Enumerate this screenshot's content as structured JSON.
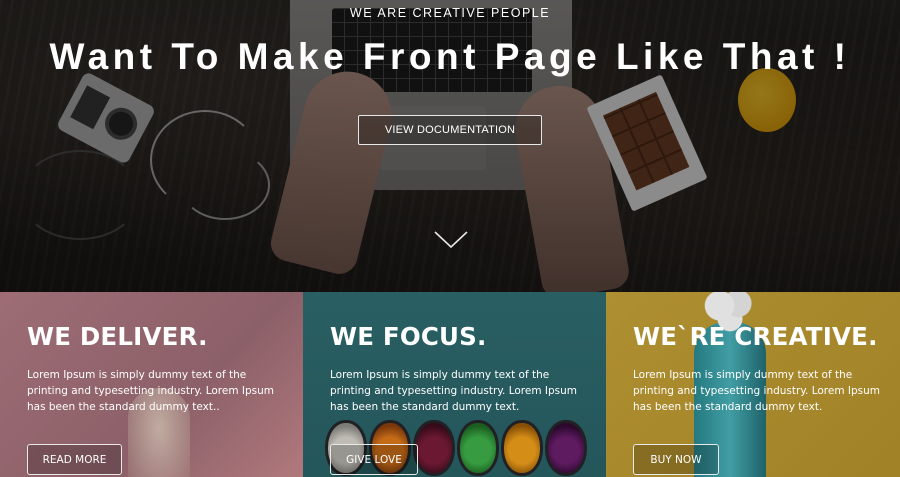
{
  "hero": {
    "subtitle": "WE ARE CREATIVE PEOPLE",
    "title": "Want To Make Front Page Like That !",
    "button_label": "VIEW DOCUMENTATION",
    "scroll_icon": "chevron-down-icon"
  },
  "panels": [
    {
      "heading": "WE DELIVER.",
      "text": "Lorem Ipsum is simply dummy text of the printing and typesetting industry. Lorem Ipsum has been the standard dummy text..",
      "button_label": "READ MORE",
      "color": "#b47c86"
    },
    {
      "heading": "WE FOCUS.",
      "text": "Lorem Ipsum is simply dummy text of the printing and typesetting industry. Lorem Ipsum has been the standard dummy text.",
      "button_label": "GIVE LOVE",
      "color": "#2f6c71"
    },
    {
      "heading": "WE`RE CREATIVE.",
      "text": "Lorem Ipsum is simply dummy text of the printing and typesetting industry. Lorem Ipsum has been the standard dummy text.",
      "button_label": "BUY NOW",
      "color": "#c6a338"
    }
  ]
}
